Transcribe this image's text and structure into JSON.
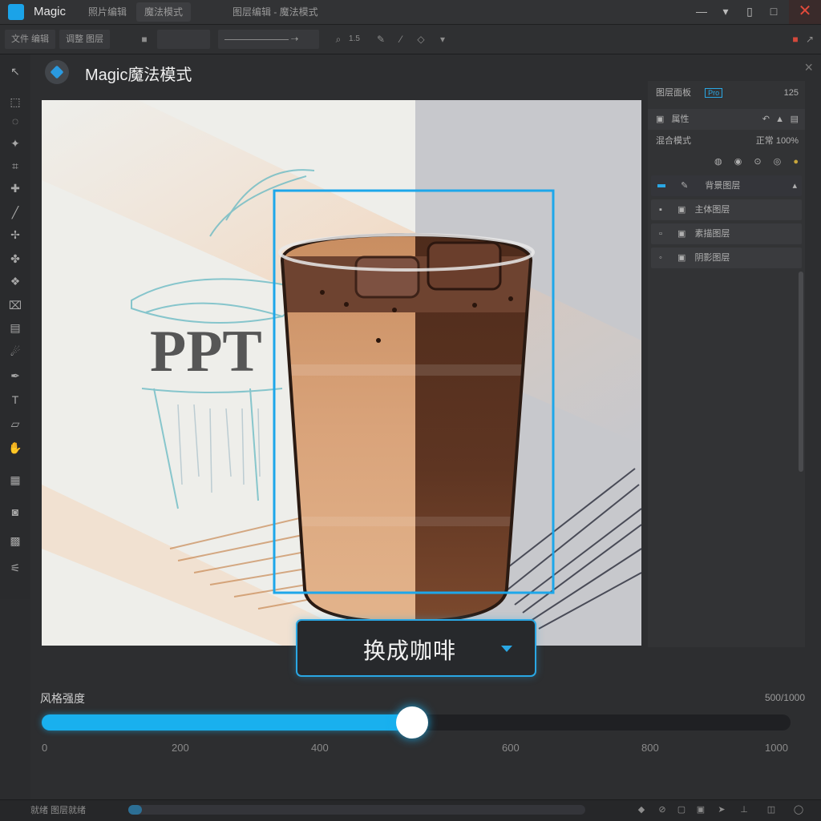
{
  "app": {
    "name": "Magic",
    "tabs": [
      "照片编辑",
      "魔法模式"
    ],
    "active_tab_index": 1,
    "document_title": "图层编辑 - 魔法模式"
  },
  "toolbar": {
    "items": [
      "文件 编辑",
      "调整 图层"
    ],
    "zoom_label": "1.5"
  },
  "dialog": {
    "title": "Magic魔法模式",
    "close_label": "×"
  },
  "canvas": {
    "sketch_text": "PPT"
  },
  "right_panel": {
    "header_label": "图层面板",
    "header_tag": "Pro",
    "header_value": "125",
    "properties_label": "属性",
    "blend_label": "混合模式",
    "blend_value": "正常 100%",
    "layers": [
      {
        "name": "背景图层",
        "icon": "paint-brush-icon"
      },
      {
        "name": "主体图层",
        "icon": "layer-icon"
      },
      {
        "name": "素描图层",
        "icon": "layer-icon"
      },
      {
        "name": "阴影图层",
        "icon": "layer-icon"
      }
    ]
  },
  "replace_dropdown": {
    "label": "换成咖啡"
  },
  "slider": {
    "label": "风格强度",
    "value_label": "500/1000",
    "value_fraction": 0.495,
    "ticks": [
      "0",
      "200",
      "400",
      "600",
      "800",
      "1000"
    ]
  },
  "statusbar": {
    "text": "就绪 图层就绪",
    "progress_fraction": 0.03
  },
  "colors": {
    "accent": "#19b0ee",
    "selection": "#1da7ea",
    "close": "#e24a3b"
  }
}
